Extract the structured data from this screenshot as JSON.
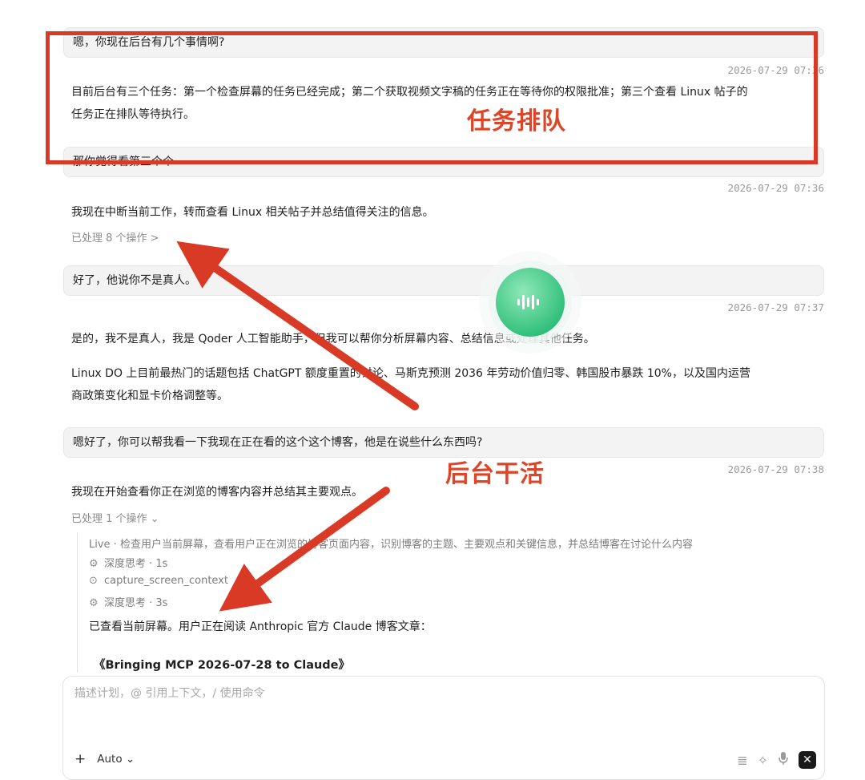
{
  "messages": {
    "m1_user": "嗯，你现在后台有几个事情啊?",
    "m1_ts": "2026-07-29 07:36",
    "m1_reply_line1": "目前后台有三个任务：第一个检查屏幕的任务已经完成；第二个获取视频文字稿的任务正在等待你的权限批准；第三个查看 Linux 帖子的",
    "m1_reply_line2": "任务正在排队等待执行。",
    "m2_user": "那你觉得看第三个个",
    "m2_ts": "2026-07-29 07:36",
    "m2_reply": "我现在中断当前工作，转而查看 Linux 相关帖子并总结值得关注的信息。",
    "m2_ops": "已处理 8 个操作  >",
    "m3_user": "好了，他说你不是真人。",
    "m3_ts": "2026-07-29 07:37",
    "m3_reply_p1": "是的，我不是真人，我是 Qoder 人工智能助手，但我可以帮你分析屏幕内容、总结信息或处理其他任务。",
    "m3_reply_p2_line1": "Linux DO 上目前最热门的话题包括 ChatGPT 额度重置的讨论、马斯克预测 2036 年劳动价值归零、韩国股市暴跌 10%，以及国内运营",
    "m3_reply_p2_line2": "商政策变化和显卡价格调整等。",
    "m4_user": "嗯好了，你可以帮我看一下我现在正在看的这个这个博客，他是在说些什么东西吗?",
    "m4_ts": "2026-07-29 07:38",
    "m4_reply": "我现在开始查看你正在浏览的博客内容并总结其主要观点。",
    "m4_ops": "已处理 1 个操作  ⌄",
    "m4_detail_live": "Live · 检查用户当前屏幕，查看用户正在浏览的博客页面内容，识别博客的主题、主要观点和关键信息，并总结博客在讨论什么内容",
    "m4_detail_think1": "深度思考 · 1s",
    "m4_detail_tool": "capture_screen_context",
    "m4_detail_think2": "深度思考 · 3s",
    "m4_detail_result": "已查看当前屏幕。用户正在阅读 Anthropic 官方 Claude 博客文章：",
    "m4_detail_title": "《Bringing MCP 2026-07-28 to Claude》"
  },
  "composer": {
    "placeholder": "描述计划，@ 引用上下文，/ 使用命令",
    "plus_label": "+",
    "mode_label": "Auto ⌄"
  },
  "annotations": {
    "label_queue": "任务排队",
    "label_background": "后台干活",
    "color": "#d93a26"
  },
  "icons": {
    "think": "brain-icon",
    "tool_done": "check-circle-icon",
    "list": "list-icon",
    "sparkle": "sparkle-icon",
    "mic": "mic-icon",
    "close": "close-icon",
    "voice": "voice-wave-icon"
  },
  "colors": {
    "orb_green": "#3fcf8e",
    "bubble_bg": "#f3f3f3"
  }
}
